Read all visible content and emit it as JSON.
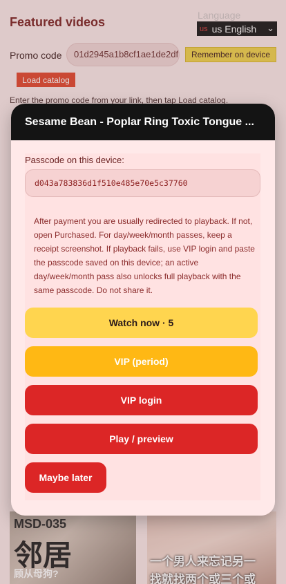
{
  "page": {
    "title": "Featured videos",
    "language_label": "Language",
    "language_flag": "us",
    "language_value": "us English",
    "promo_label": "Promo code",
    "promo_value": "01d2945a1b8cf1ae1de2df",
    "remember_button": "Remember on device",
    "load_button": "Load catalog",
    "hint": "Enter the promo code from your link, then tap Load catalog.",
    "thumbs": [
      {
        "code": "MSD-035",
        "title": "邻居",
        "subtitle": "顾从母狗?"
      },
      {
        "line1": "一个男人来忘记另一",
        "line2": "找就找两个或三个或"
      }
    ]
  },
  "modal": {
    "title": "Sesame Bean - Poplar Ring Toxic Tongue ...",
    "passcode_label": "Passcode on this device:",
    "passcode_value": "d043a783836d1f510e485e70e5c37760",
    "notice": "After payment you are usually redirected to playback. If not, open Purchased. For day/week/month passes, keep a receipt screenshot. If playback fails, use VIP login and paste the passcode saved on this device; an active day/week/month pass also unlocks full playback with the same passcode. Do not share it.",
    "buttons": {
      "watch_now": "Watch now · 5",
      "vip_period": "VIP (period)",
      "vip_login": "VIP login",
      "play_preview": "Play / preview",
      "maybe_later": "Maybe later"
    }
  },
  "colors": {
    "header_bg": "#141414",
    "watch_yellow": "#ffd54f",
    "vip_orange": "#ffb814",
    "red": "#dc2626"
  }
}
